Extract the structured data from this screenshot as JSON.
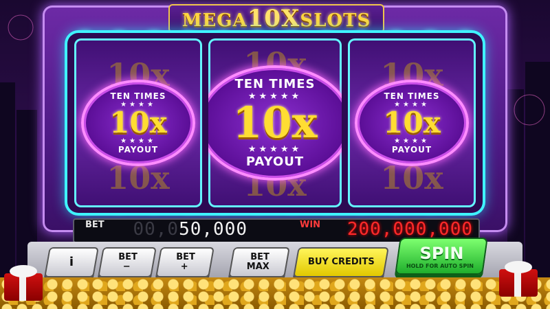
{
  "game": {
    "title_prefix": "MEGA",
    "title_ten": "10",
    "title_x": "X",
    "title_suffix": "SLOTS"
  },
  "reels": [
    {
      "symbol_top": "TEN TIMES",
      "symbol_mult": "10x",
      "symbol_bottom": "PAYOUT",
      "ghost": "10x"
    },
    {
      "symbol_top": "TEN TIMES",
      "symbol_mult": "10x",
      "symbol_bottom": "PAYOUT",
      "ghost": "10x"
    },
    {
      "symbol_top": "TEN TIMES",
      "symbol_mult": "10x",
      "symbol_bottom": "PAYOUT",
      "ghost": "10x"
    }
  ],
  "meters": {
    "bet_label": "BET",
    "bet_ghost": "00,0",
    "bet_value": "50,000",
    "win_label": "WIN",
    "win_value": "200,000,000"
  },
  "controls": {
    "info": "i",
    "bet_minus_top": "BET",
    "bet_minus_sym": "−",
    "bet_plus_top": "BET",
    "bet_plus_sym": "+",
    "bet_max_top": "BET",
    "bet_max_bottom": "MAX",
    "buy_credits": "BUY CREDITS",
    "spin": "SPIN",
    "spin_hint": "HOLD FOR AUTO SPIN"
  },
  "colors": {
    "accent_gold": "#ffdd33",
    "reel_glow": "#3ff3ff",
    "win_red": "#ff2a2a",
    "spin_green": "#1fae2c"
  }
}
